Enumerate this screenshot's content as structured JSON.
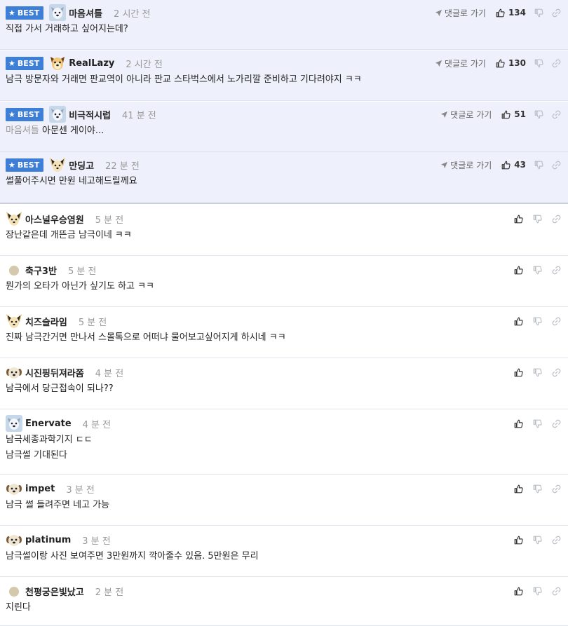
{
  "best_comments": [
    {
      "badge": "BEST",
      "avatar": "dog-white-avatar",
      "nick": "마음셔틀",
      "time": "2 시간 전",
      "goto": "댓글로 가기",
      "likes": "134",
      "lines": [
        "직접 가서 거래하고 싶어지는데?"
      ]
    },
    {
      "badge": "BEST",
      "avatar": "dog-brown-avatar",
      "nick": "RealLazy",
      "time": "2 시간 전",
      "goto": "댓글로 가기",
      "likes": "130",
      "lines": [
        "남극 방문자와 거래면 판교역이 아니라 판교 스타벅스에서 노가리깔 준비하고 기다려야지 ㅋㅋ"
      ]
    },
    {
      "badge": "BEST",
      "avatar": "dog-white-avatar",
      "nick": "비극적시럽",
      "time": "41 분 전",
      "goto": "댓글로 가기",
      "likes": "51",
      "reply_to": "마음셔틀",
      "lines": [
        "아문센 게이야..."
      ]
    },
    {
      "badge": "BEST",
      "avatar": "dog-cream-avatar",
      "nick": "만딩고",
      "time": "22 분 전",
      "goto": "댓글로 가기",
      "likes": "43",
      "lines": [
        "썰풀어주시면 만원 네고해드릴께요"
      ]
    }
  ],
  "comments": [
    {
      "avatar": "dog-cream-avatar",
      "nick": "아스널우승염원",
      "time": "5 분 전",
      "lines": [
        "장난같은데 개뜬금 남극이네 ㅋㅋ"
      ]
    },
    {
      "avatar": "dot-avatar",
      "nick": "축구3반",
      "time": "5 분 전",
      "lines": [
        "뭔가의 오타가 아닌가 싶기도 하고 ㅋㅋ"
      ]
    },
    {
      "avatar": "dog-cream-avatar",
      "nick": "치즈슬라임",
      "time": "5 분 전",
      "lines": [
        "진짜 남극간거면 만나서 스몰톡으로 어떠냐 물어보고싶어지게 하시네 ㅋㅋ"
      ]
    },
    {
      "avatar": "puppy-avatar",
      "nick": "시진핑뒤져라쫌",
      "time": "4 분 전",
      "lines": [
        "남극에서 당근접속이 되나??"
      ]
    },
    {
      "avatar": "dog-white-avatar",
      "nick": "Enervate",
      "time": "4 분 전",
      "lines": [
        "남극세종과학기지 ㄷㄷ",
        "남극썰 기대된다"
      ]
    },
    {
      "avatar": "puppy-avatar",
      "nick": "impet",
      "time": "3 분 전",
      "lines": [
        "남극 썰 들려주면 네고 가능"
      ]
    },
    {
      "avatar": "puppy-avatar",
      "nick": "platinum",
      "time": "3 분 전",
      "lines": [
        "남극썰이랑 사진 보여주면 3만원까지 깍아줄수 있음. 5만원은 무리"
      ]
    },
    {
      "avatar": "dot-avatar",
      "nick": "천평궁은빛났고",
      "time": "2 분 전",
      "lines": [
        "지린다"
      ]
    }
  ],
  "icons": {
    "like": "thumbs-up-icon",
    "dislike": "thumbs-down-icon",
    "link": "link-icon",
    "goto": "send-arrow-icon",
    "badge": "star-icon"
  },
  "colors": {
    "badge": "#3d7ed6",
    "best_bg": "#eef1fb",
    "time": "#999999"
  }
}
